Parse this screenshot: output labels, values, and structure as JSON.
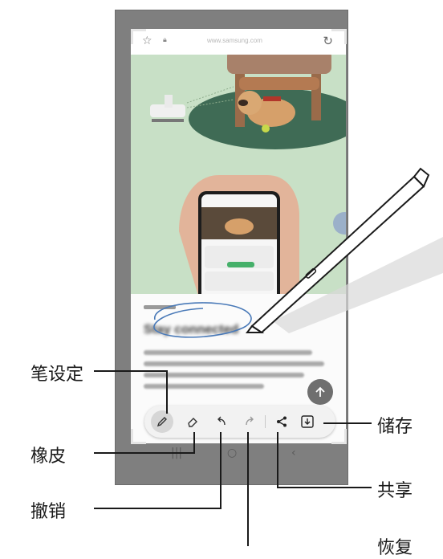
{
  "browser": {
    "url": "www.samsung.com"
  },
  "article": {
    "headline": "Stay connected"
  },
  "toolbar": {
    "tools": [
      {
        "id": "pen-settings",
        "icon": "pen-icon",
        "active": true
      },
      {
        "id": "eraser",
        "icon": "eraser-icon",
        "active": false
      },
      {
        "id": "undo",
        "icon": "undo-icon",
        "active": false
      },
      {
        "id": "redo",
        "icon": "redo-icon",
        "active": false
      },
      {
        "id": "share",
        "icon": "share-icon",
        "active": false
      },
      {
        "id": "save",
        "icon": "save-icon",
        "active": false
      }
    ]
  },
  "callouts": {
    "pen_settings": "笔设定",
    "eraser": "橡皮",
    "undo": "撤销",
    "redo": "恢复",
    "share": "共享",
    "save": "储存"
  },
  "colors": {
    "hero_green": "#c8e0c6",
    "ink_blue": "#4a7ab8",
    "toolbar_bg": "#f2f2f2",
    "callout_line": "#1a1a1a"
  }
}
